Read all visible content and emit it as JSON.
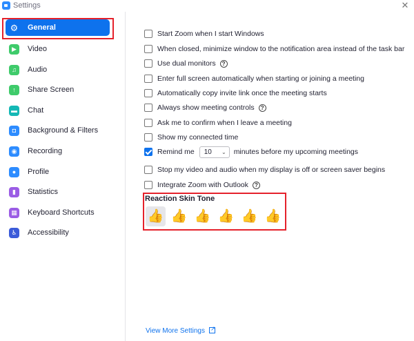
{
  "window": {
    "title": "Settings",
    "close_glyph": "✕"
  },
  "sidebar": {
    "items": [
      {
        "label": "General",
        "icon": "gear-icon",
        "color": "#ffffff",
        "glyph": "⚙"
      },
      {
        "label": "Video",
        "icon": "video-icon",
        "color": "#3FCB6B",
        "glyph": "▶"
      },
      {
        "label": "Audio",
        "icon": "headphones-icon",
        "color": "#3FCB6B",
        "glyph": "♫"
      },
      {
        "label": "Share Screen",
        "icon": "share-screen-icon",
        "color": "#3FCB6B",
        "glyph": "↑"
      },
      {
        "label": "Chat",
        "icon": "chat-icon",
        "color": "#14B8B5",
        "glyph": "▬"
      },
      {
        "label": "Background & Filters",
        "icon": "background-icon",
        "color": "#2D8CFF",
        "glyph": "◘"
      },
      {
        "label": "Recording",
        "icon": "recording-icon",
        "color": "#2D8CFF",
        "glyph": "◉"
      },
      {
        "label": "Profile",
        "icon": "profile-icon",
        "color": "#2D8CFF",
        "glyph": "●"
      },
      {
        "label": "Statistics",
        "icon": "statistics-icon",
        "color": "#9B5DE5",
        "glyph": "▮"
      },
      {
        "label": "Keyboard Shortcuts",
        "icon": "keyboard-icon",
        "color": "#9B5DE5",
        "glyph": "▦"
      },
      {
        "label": "Accessibility",
        "icon": "accessibility-icon",
        "color": "#3B5BD9",
        "glyph": "♿"
      }
    ],
    "selected": "General"
  },
  "general": {
    "options": [
      {
        "label": "Start Zoom when I start Windows",
        "checked": false,
        "help": false
      },
      {
        "label": "When closed, minimize window to the notification area instead of the task bar",
        "checked": false,
        "help": false
      },
      {
        "label": "Use dual monitors",
        "checked": false,
        "help": true
      },
      {
        "label": "Enter full screen automatically when starting or joining a meeting",
        "checked": false,
        "help": false
      },
      {
        "label": "Automatically copy invite link once the meeting starts",
        "checked": false,
        "help": false
      },
      {
        "label": "Always show meeting controls",
        "checked": false,
        "help": true
      },
      {
        "label": "Ask me to confirm when I leave a meeting",
        "checked": false,
        "help": false
      },
      {
        "label": "Show my connected time",
        "checked": false,
        "help": false
      }
    ],
    "remind": {
      "label_before": "Remind me",
      "value": "10",
      "label_after": "minutes before my upcoming meetings",
      "checked": true
    },
    "options2": [
      {
        "label": "Stop my video and audio when my display is off or screen saver begins",
        "checked": false,
        "help": false
      },
      {
        "label": "Integrate Zoom with Outlook",
        "checked": false,
        "help": true
      }
    ],
    "skin_tone": {
      "title": "Reaction Skin Tone",
      "tones": [
        {
          "glyph": "👍",
          "color": "#FFC83D",
          "selected": true
        },
        {
          "glyph": "👍",
          "color": "#F7DECE",
          "selected": false
        },
        {
          "glyph": "👍",
          "color": "#E0BB95",
          "selected": false
        },
        {
          "glyph": "👍",
          "color": "#BF8F68",
          "selected": false
        },
        {
          "glyph": "👍",
          "color": "#9B643D",
          "selected": false
        },
        {
          "glyph": "👍",
          "color": "#594539",
          "selected": false
        }
      ]
    },
    "view_more": "View More Settings"
  }
}
